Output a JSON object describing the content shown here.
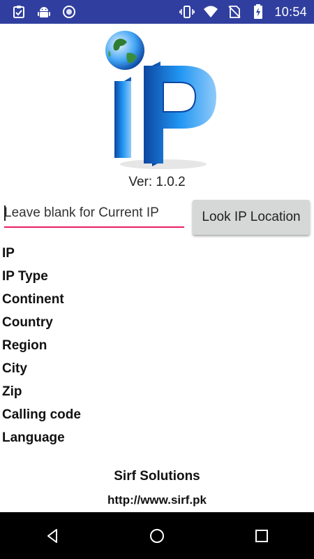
{
  "status_bar": {
    "time": "10:54",
    "left_icons": [
      "checklist-icon",
      "android-icon",
      "sync-icon"
    ],
    "right_icons": [
      "vibrate-icon",
      "wifi-icon",
      "no-sim-icon",
      "battery-charging-icon"
    ]
  },
  "app": {
    "logo_text": "iP",
    "version": "Ver: 1.0.2"
  },
  "search": {
    "placeholder": "Leave blank for Current IP",
    "value": "",
    "button_label": "Look IP Location"
  },
  "fields": [
    {
      "label": "IP"
    },
    {
      "label": "IP Type"
    },
    {
      "label": "Continent"
    },
    {
      "label": "Country"
    },
    {
      "label": "Region"
    },
    {
      "label": "City"
    },
    {
      "label": "Zip"
    },
    {
      "label": "Calling code"
    },
    {
      "label": "Language"
    }
  ],
  "footer": {
    "company": "Sirf Solutions",
    "url": "http://www.sirf.pk"
  },
  "nav": {
    "icons": [
      "back-icon",
      "home-icon",
      "recents-icon"
    ]
  },
  "colors": {
    "status_bar": "#303f9f",
    "accent_underline": "#e91e63",
    "button_bg": "#d6d7d7",
    "logo_blue": "#1e88e5"
  }
}
